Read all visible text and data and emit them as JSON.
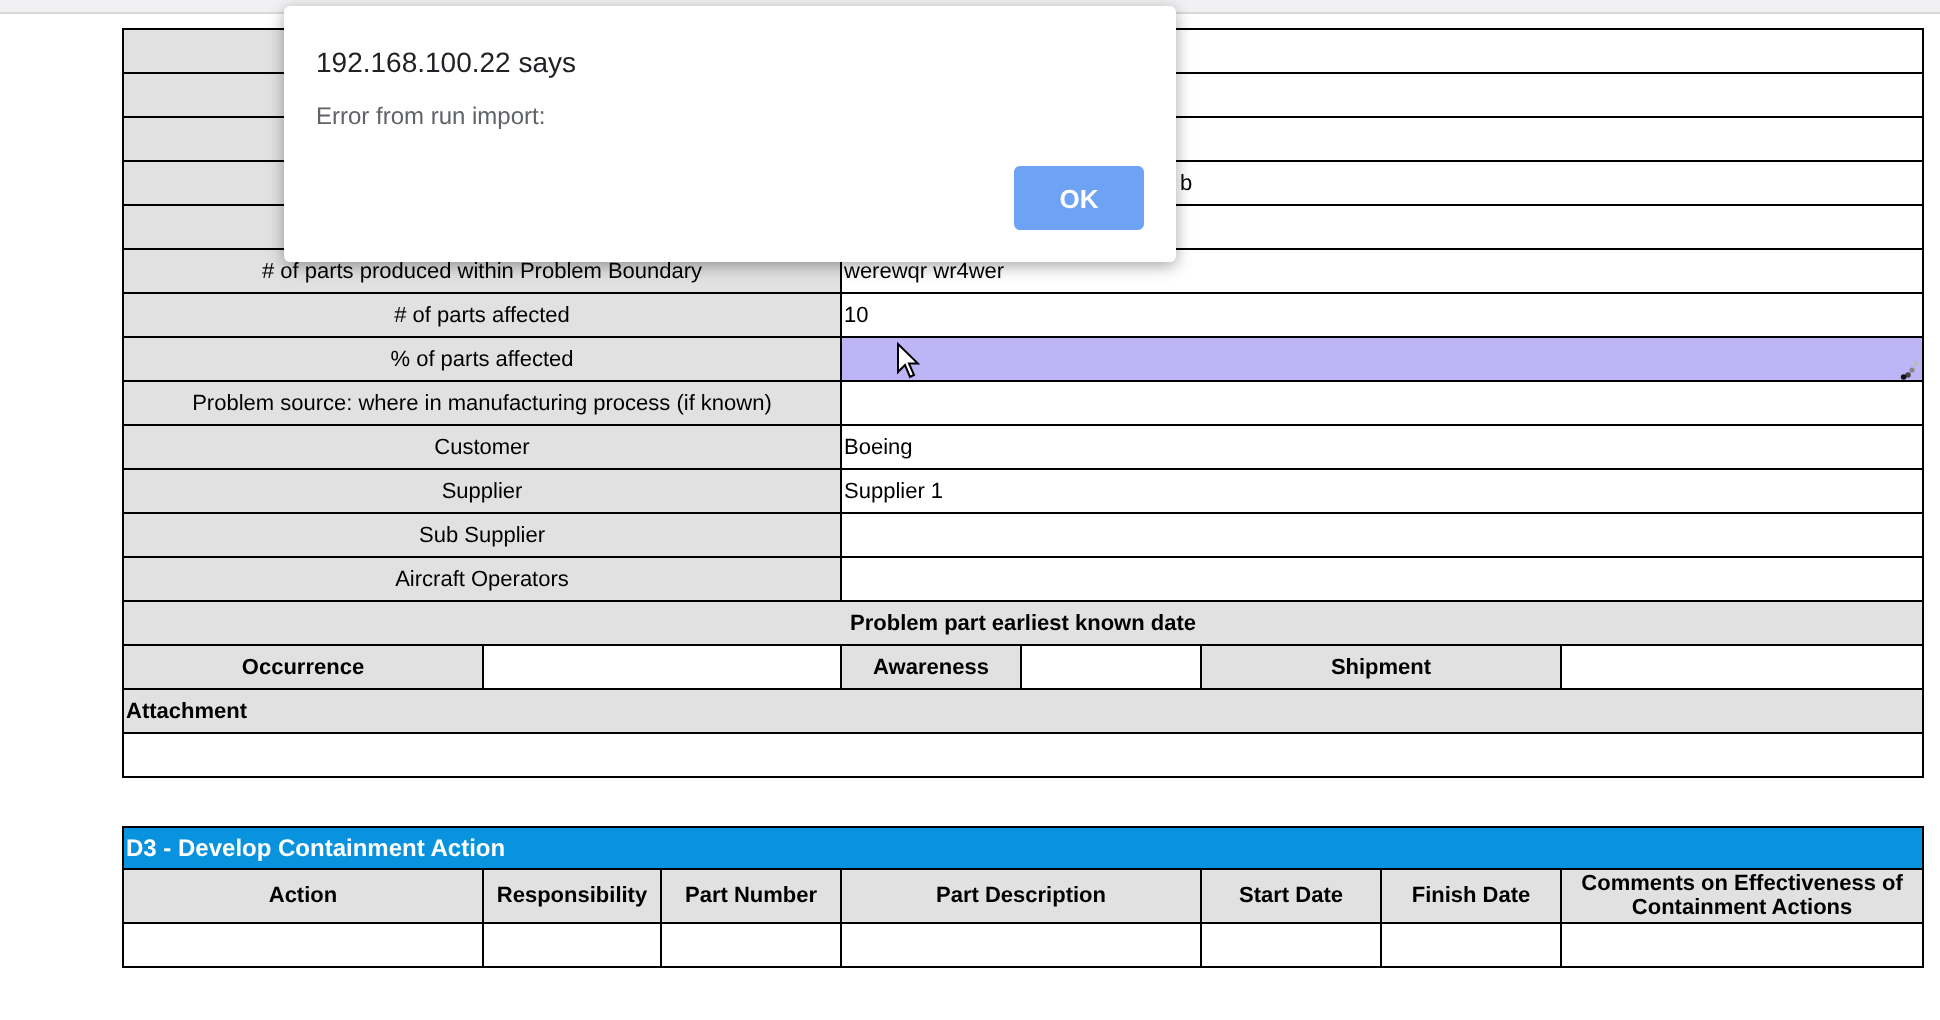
{
  "dialog": {
    "title": "192.168.100.22 says",
    "message": "Error from run import:",
    "button": "OK"
  },
  "form": {
    "rows": [
      {
        "selected": false
      },
      {
        "selected": false
      },
      {
        "selected": false
      },
      {
        "value": "b",
        "selected": false
      },
      {
        "selected": false
      },
      {
        "label": "# of parts produced within Problem Boundary",
        "value": "werewqr wr4wer",
        "selected": false
      },
      {
        "label": "# of parts affected",
        "value": "10",
        "selected": false
      },
      {
        "label": "% of parts affected",
        "selected": true
      },
      {
        "label": "Problem source: where in manufacturing process (if known)",
        "selected": false
      },
      {
        "label": "Customer",
        "value": "Boeing",
        "selected": false
      },
      {
        "label": "Supplier",
        "value": "Supplier 1",
        "selected": false
      },
      {
        "label": "Sub Supplier",
        "selected": false
      },
      {
        "label": "Aircraft Operators",
        "selected": false
      }
    ],
    "dates": {
      "title": "Problem part earliest known date",
      "fields": [
        {
          "label": "Occurrence"
        },
        {
          "label": "Awareness"
        },
        {
          "label": "Shipment"
        }
      ]
    },
    "attachment": {
      "label": "Attachment"
    }
  },
  "containment": {
    "title": "D3 - Develop Containment Action",
    "columns": [
      "Action",
      "Responsibility",
      "Part Number",
      "Part Description",
      "Start Date",
      "Finish Date",
      "Comments on Effectiveness of Containment Actions"
    ]
  }
}
